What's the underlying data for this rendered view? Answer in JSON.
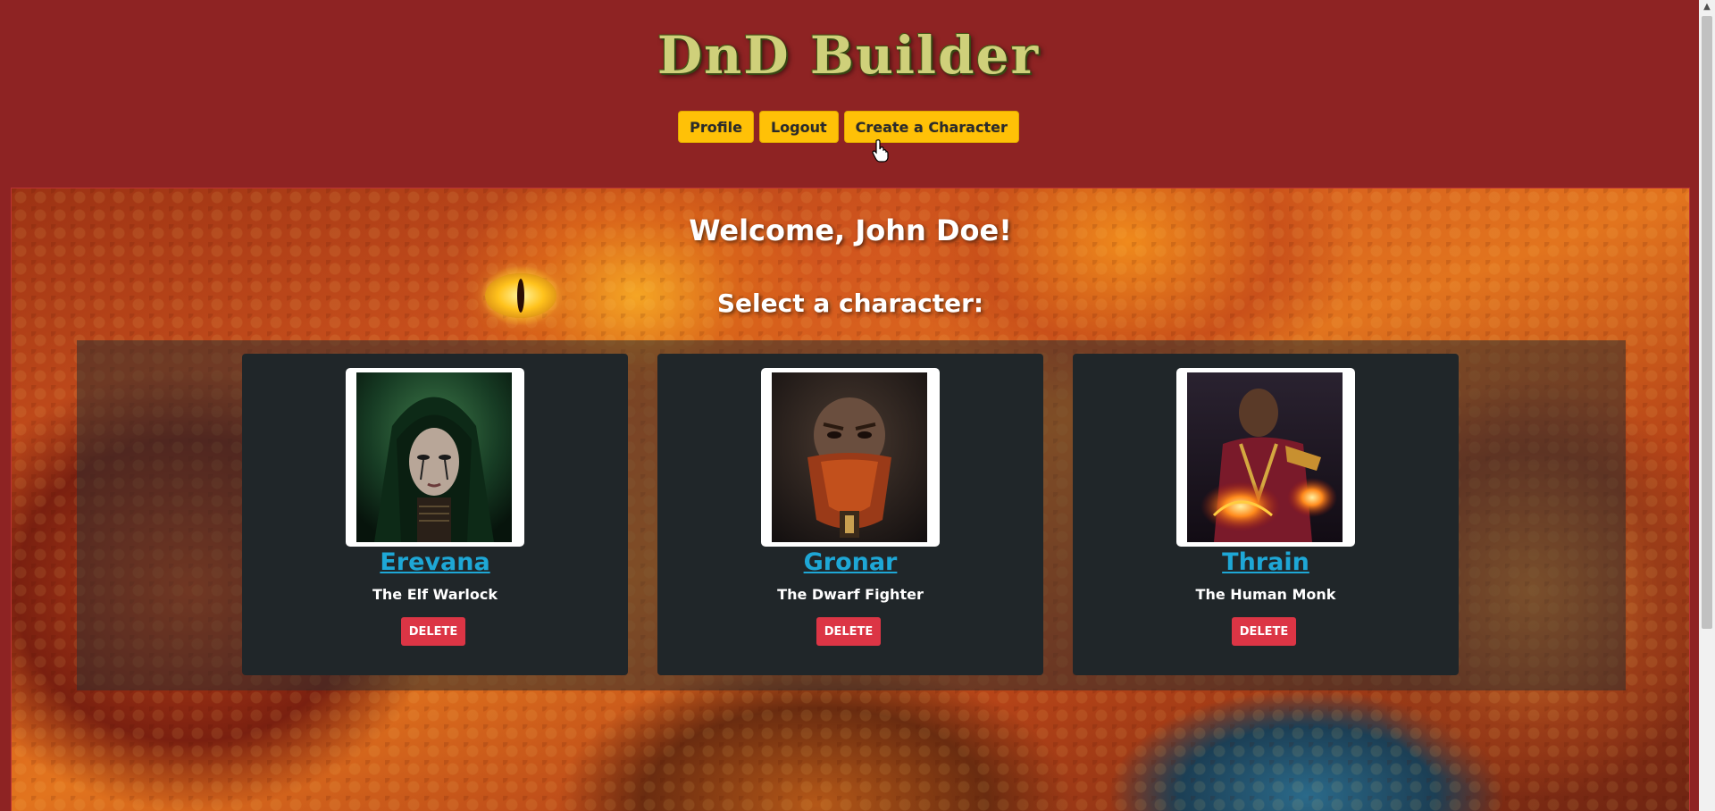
{
  "site": {
    "title": "DnD Builder"
  },
  "nav": {
    "items": [
      {
        "label": "Profile"
      },
      {
        "label": "Logout"
      },
      {
        "label": "Create a Character"
      }
    ]
  },
  "main": {
    "welcome": "Welcome, John Doe!",
    "select_heading": "Select a character:"
  },
  "characters": [
    {
      "name": "Erevana",
      "description": "The Elf Warlock",
      "delete_label": "DELETE"
    },
    {
      "name": "Gronar",
      "description": "The Dwarf Fighter",
      "delete_label": "DELETE"
    },
    {
      "name": "Thrain",
      "description": "The Human Monk",
      "delete_label": "DELETE"
    }
  ],
  "colors": {
    "page_bg": "#8e2323",
    "nav_button": "#ffc107",
    "card_bg": "#202629",
    "link": "#1ea7d6",
    "danger": "#dc3545"
  },
  "icons": {
    "cursor": "hand-pointer-icon",
    "scroll_up": "arrow-up-icon"
  }
}
